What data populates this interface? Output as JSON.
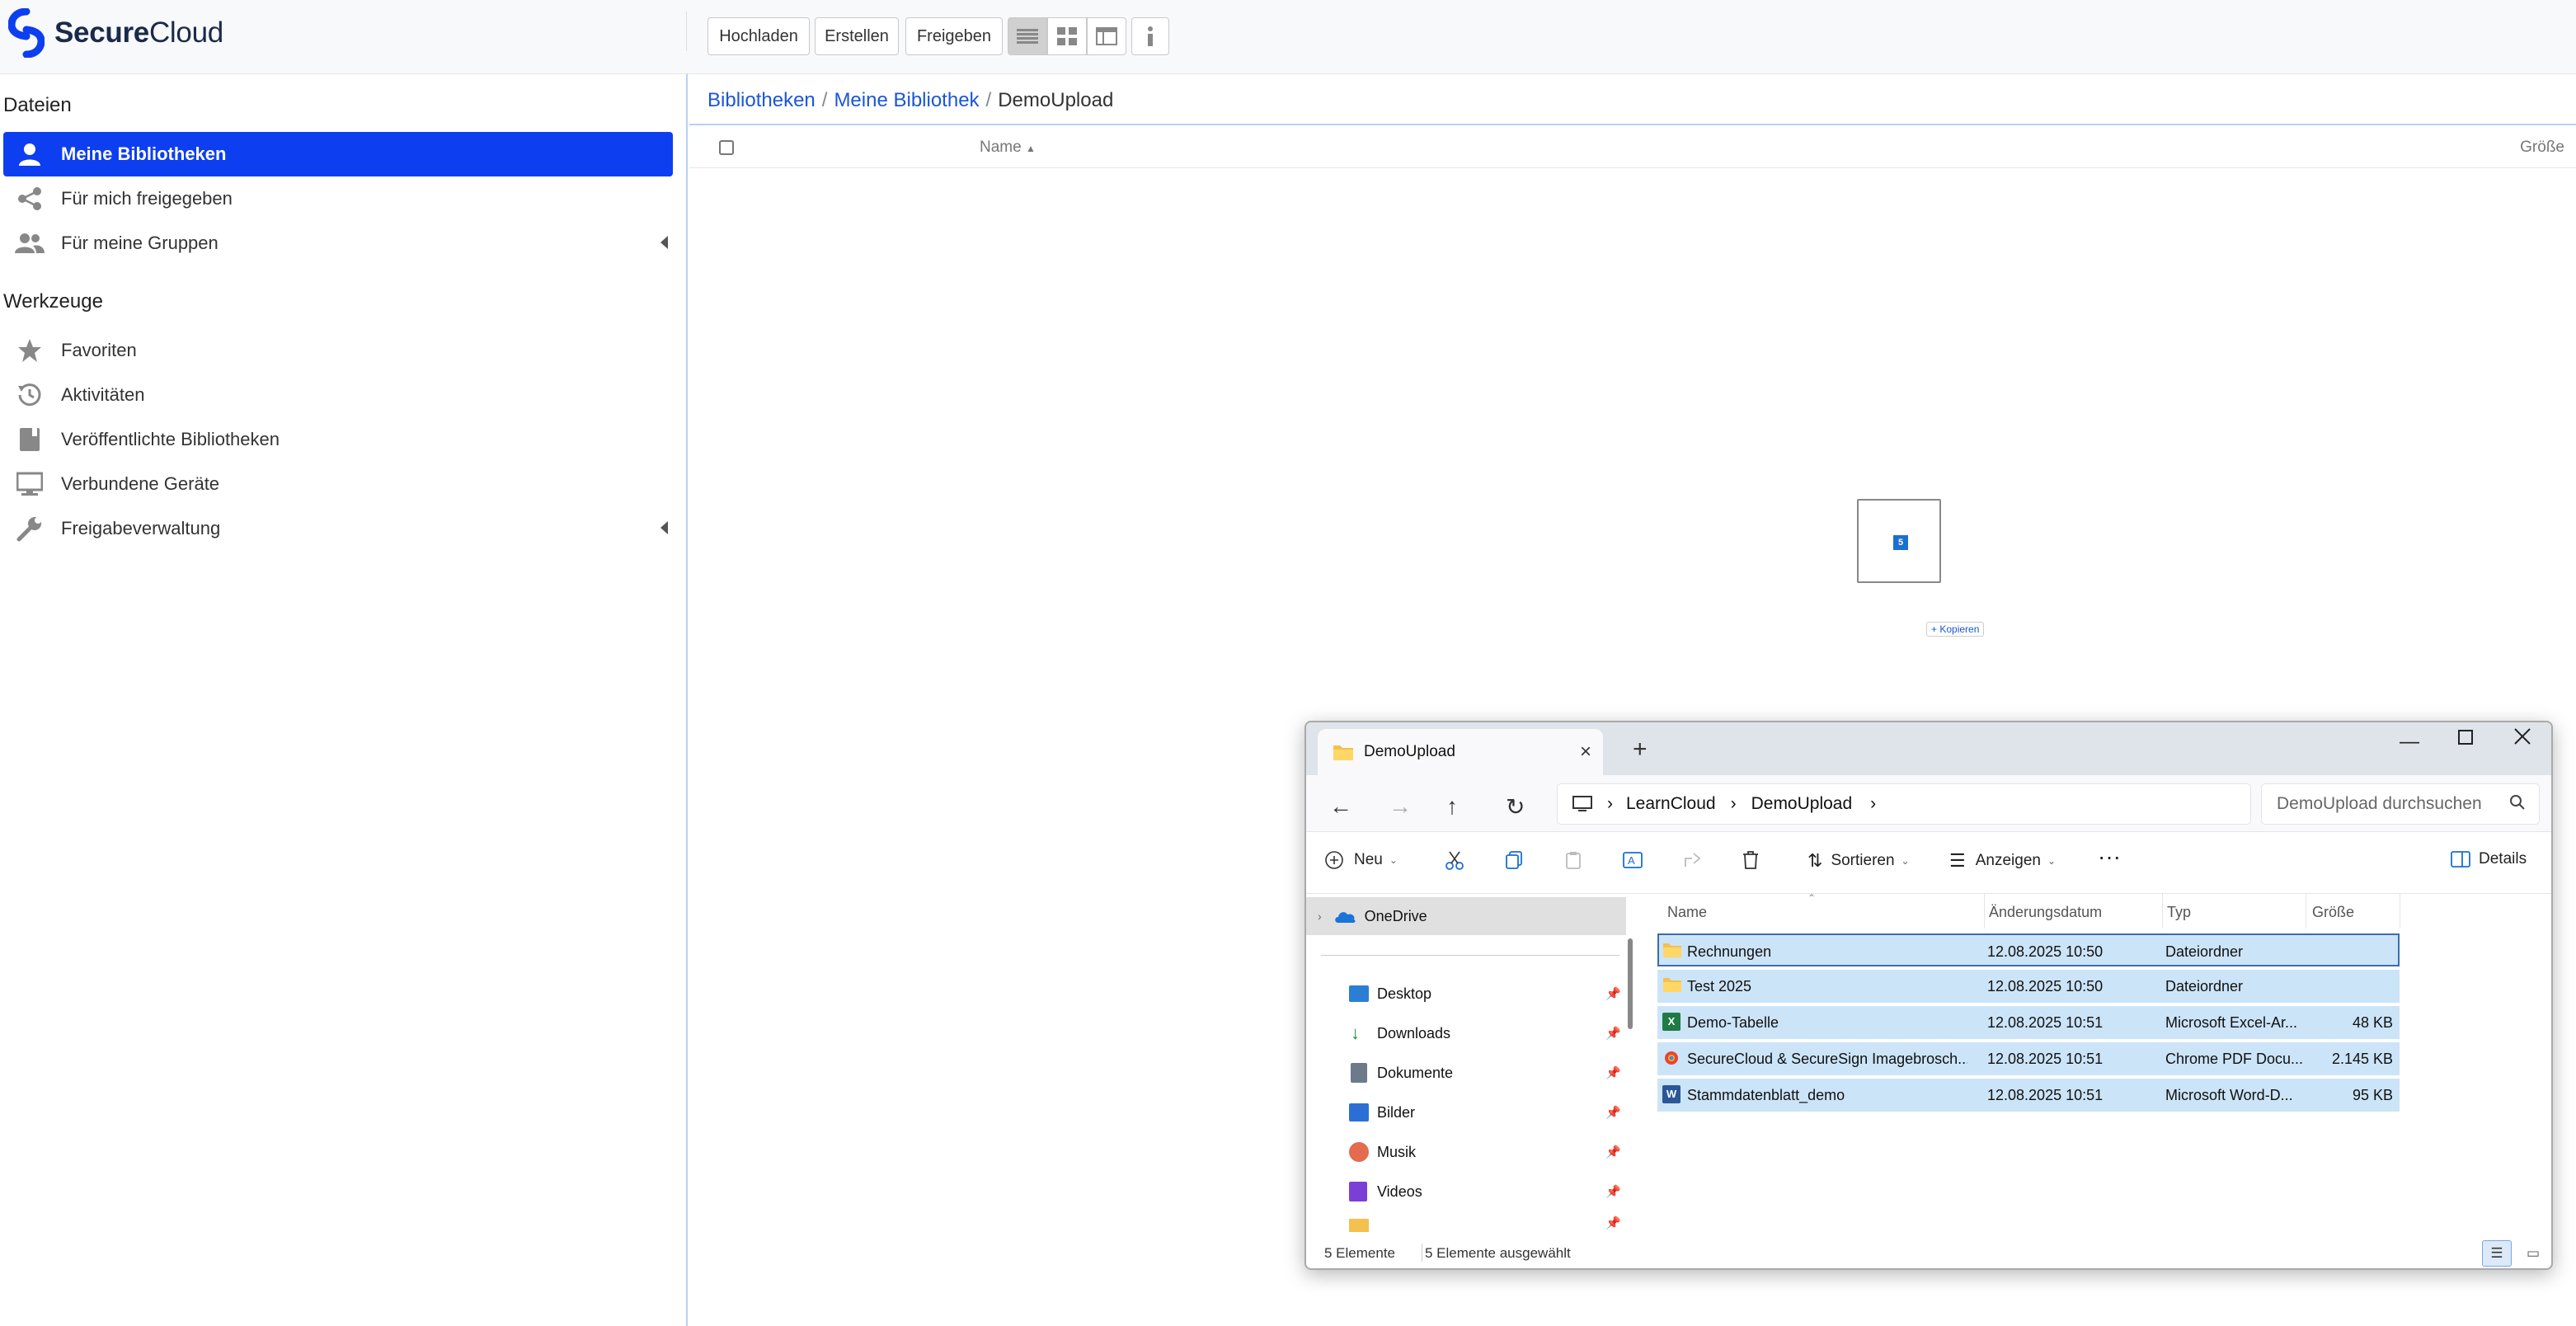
{
  "app": {
    "brand_bold": "Secure",
    "brand_light": "Cloud"
  },
  "toolbar": {
    "upload": "Hochladen",
    "create": "Erstellen",
    "share": "Freigeben"
  },
  "sidebar": {
    "files_heading": "Dateien",
    "files_items": [
      {
        "label": "Meine Bibliotheken",
        "icon": "user-icon",
        "active": true
      },
      {
        "label": "Für mich freigegeben",
        "icon": "share-icon"
      },
      {
        "label": "Für meine Gruppen",
        "icon": "group-icon"
      }
    ],
    "tools_heading": "Werkzeuge",
    "tools_items": [
      {
        "label": "Favoriten",
        "icon": "star-icon"
      },
      {
        "label": "Aktivitäten",
        "icon": "history-icon"
      },
      {
        "label": "Veröffentlichte Bibliotheken",
        "icon": "book-icon"
      },
      {
        "label": "Verbundene Geräte",
        "icon": "monitor-icon"
      },
      {
        "label": "Freigabeverwaltung",
        "icon": "wrench-icon"
      }
    ]
  },
  "breadcrumb": {
    "root": "Bibliotheken",
    "library": "Meine Bibliothek",
    "current": "DemoUpload"
  },
  "table": {
    "col_name": "Name",
    "col_size": "Größe"
  },
  "drag": {
    "count": "5",
    "copy_label": "+ Kopieren"
  },
  "explorer": {
    "tab_title": "DemoUpload",
    "address": {
      "part1": "LearnCloud",
      "part2": "DemoUpload"
    },
    "search_placeholder": "DemoUpload durchsuchen",
    "toolbar": {
      "new": "Neu",
      "sort": "Sortieren",
      "view": "Anzeigen",
      "details": "Details"
    },
    "nav": {
      "onedrive": "OneDrive",
      "items": [
        {
          "label": "Desktop",
          "color": "#2a7fd4"
        },
        {
          "label": "Downloads",
          "color": "#1f8a4c"
        },
        {
          "label": "Dokumente",
          "color": "#6d7a8c"
        },
        {
          "label": "Bilder",
          "color": "#2b6fd6"
        },
        {
          "label": "Musik",
          "color": "#e36b4f"
        },
        {
          "label": "Videos",
          "color": "#7b3fd6"
        }
      ]
    },
    "columns": {
      "name": "Name",
      "date": "Änderungsdatum",
      "type": "Typ",
      "size": "Größe"
    },
    "files": [
      {
        "name": "Rechnungen",
        "date": "12.08.2025 10:50",
        "type": "Dateiordner",
        "size": "",
        "kind": "folder"
      },
      {
        "name": "Test 2025",
        "date": "12.08.2025 10:50",
        "type": "Dateiordner",
        "size": "",
        "kind": "folder"
      },
      {
        "name": "Demo-Tabelle",
        "date": "12.08.2025 10:51",
        "type": "Microsoft Excel-Ar...",
        "size": "48 KB",
        "kind": "excel"
      },
      {
        "name": "SecureCloud & SecureSign Imagebrosch...",
        "date": "12.08.2025 10:51",
        "type": "Chrome PDF Docu...",
        "size": "2.145 KB",
        "kind": "pdf"
      },
      {
        "name": "Stammdatenblatt_demo",
        "date": "12.08.2025 10:51",
        "type": "Microsoft Word-D...",
        "size": "95 KB",
        "kind": "word"
      }
    ],
    "status": {
      "count": "5 Elemente",
      "selected": "5 Elemente ausgewählt"
    }
  }
}
